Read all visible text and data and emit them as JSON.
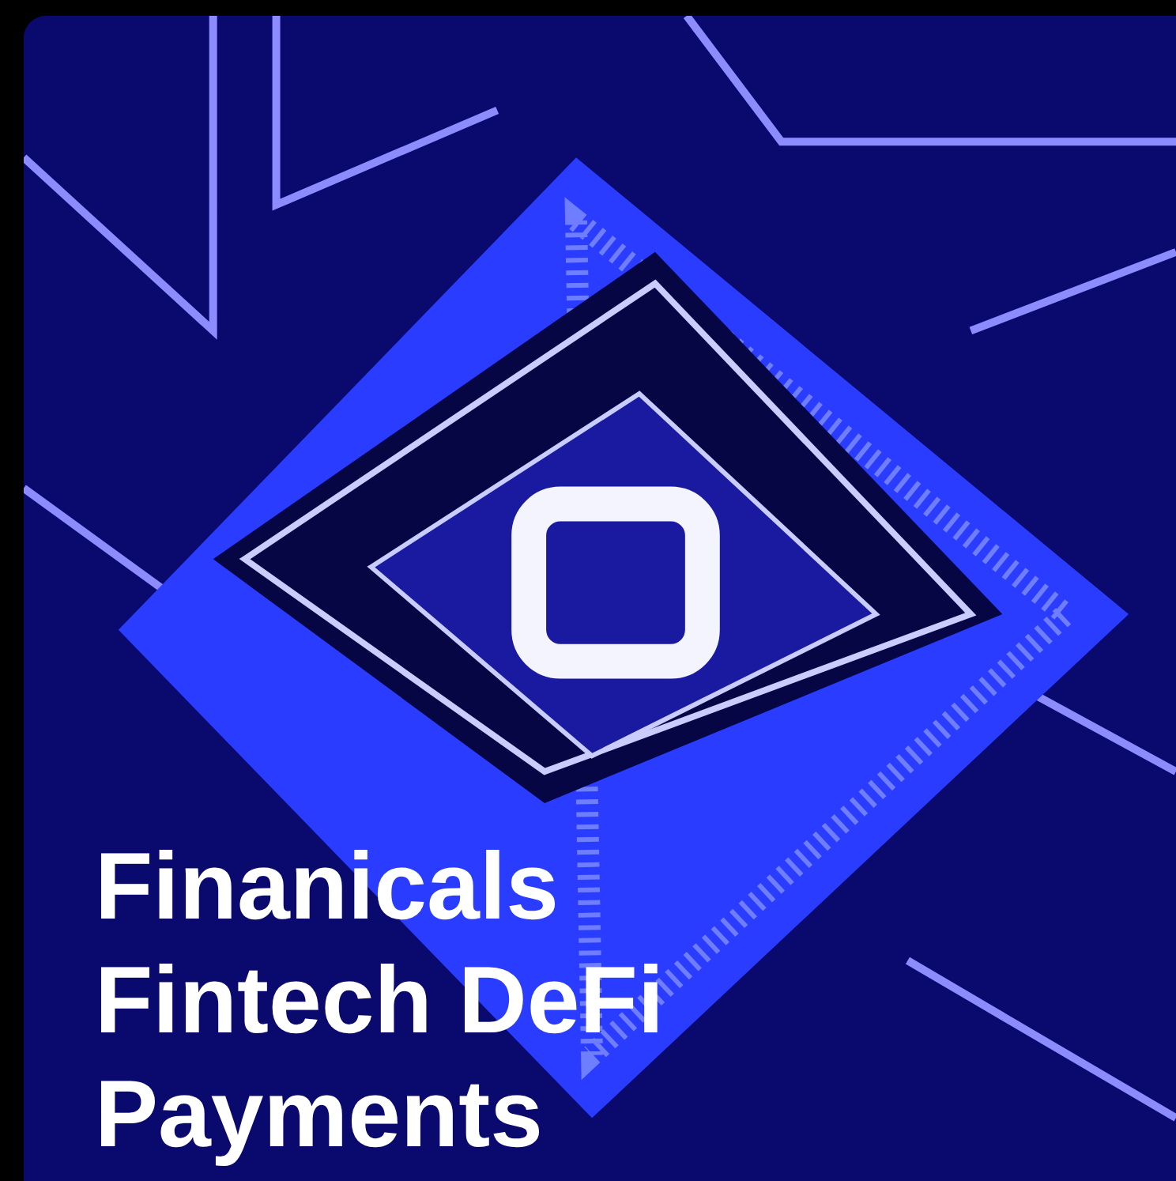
{
  "card": {
    "kind": "picture",
    "title": "Finanicals Fintech DeFi Payments"
  }
}
